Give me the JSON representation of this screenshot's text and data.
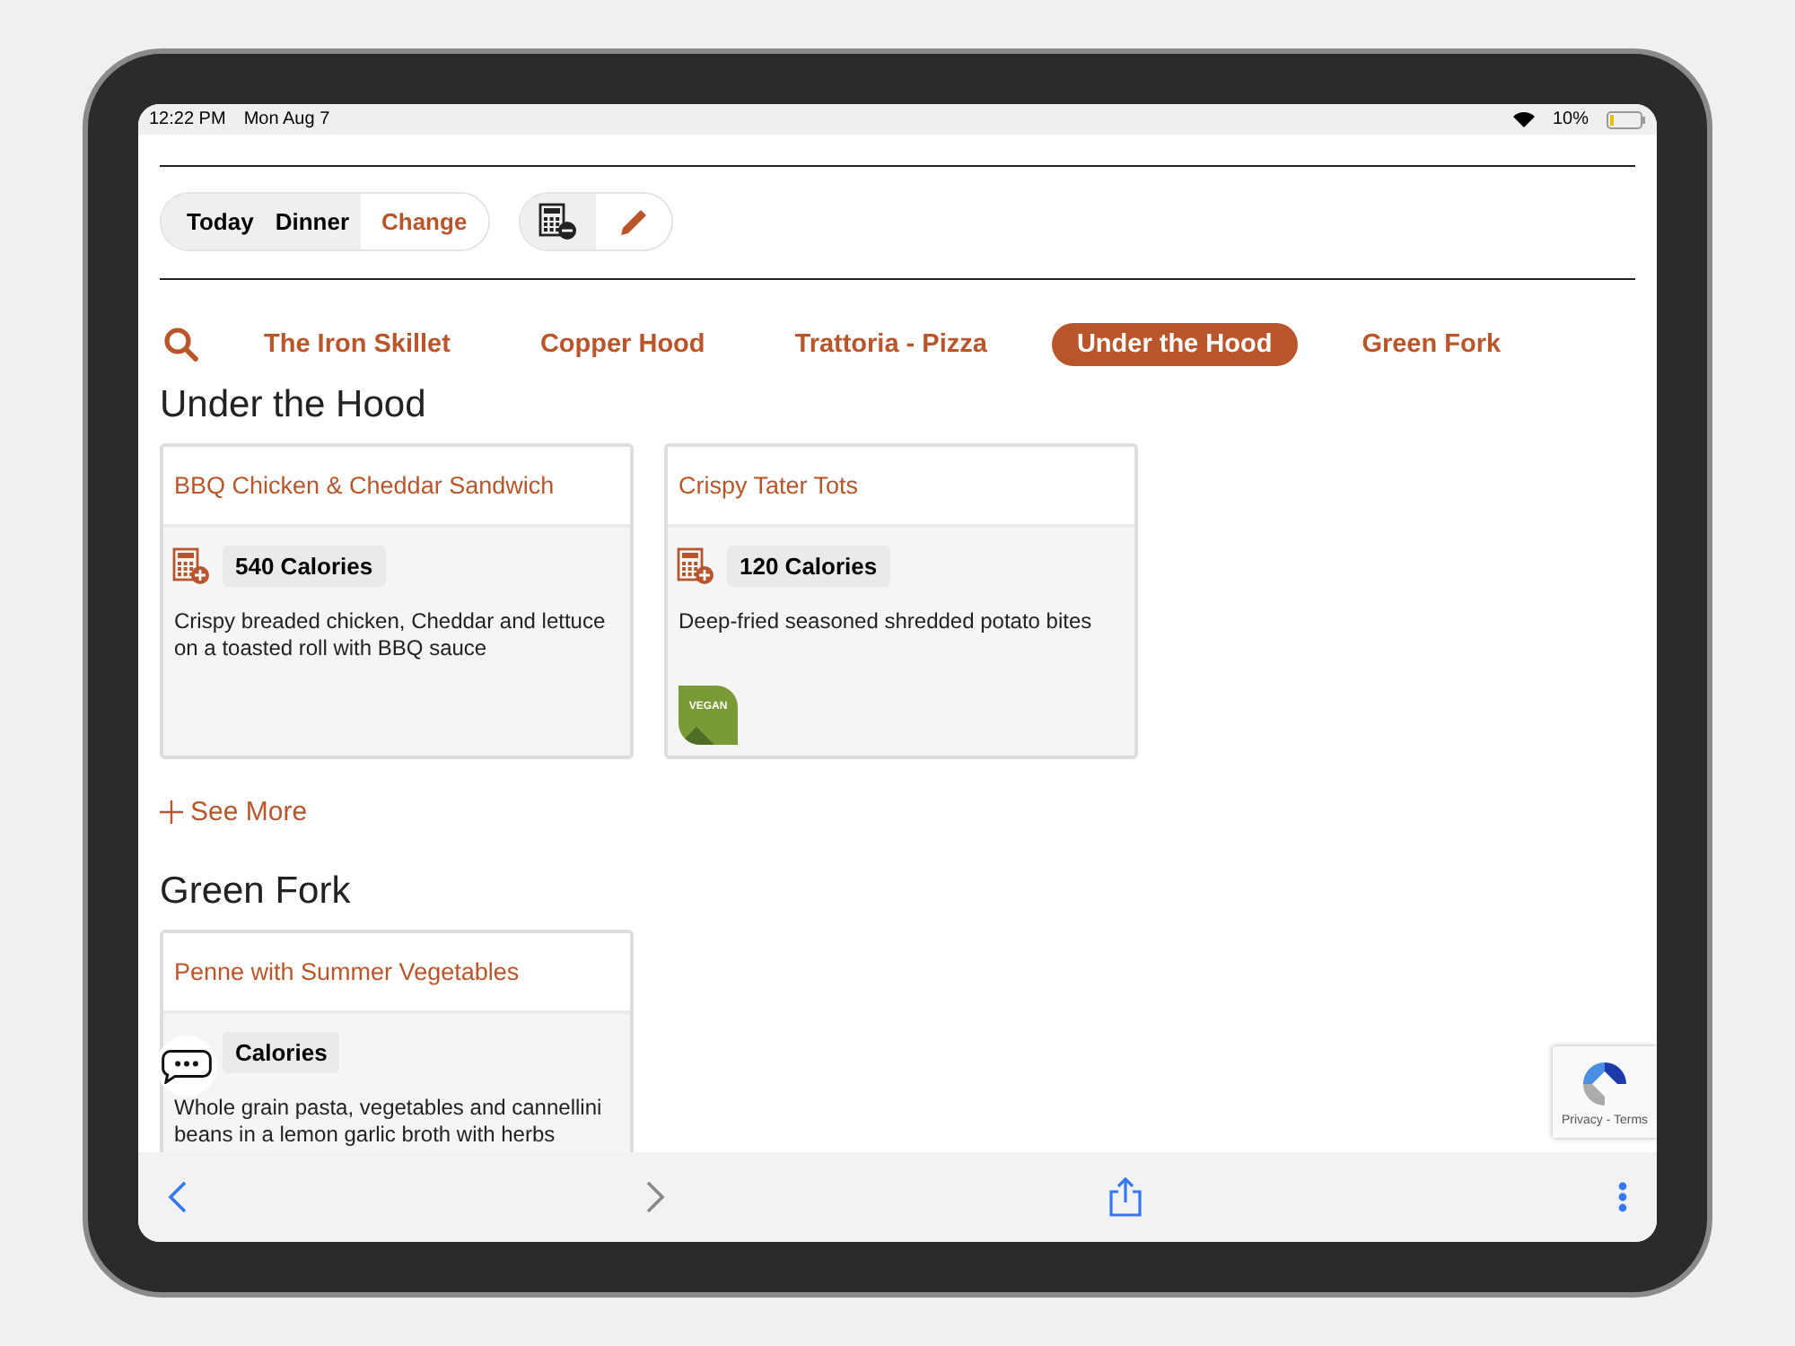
{
  "status_bar": {
    "time": "12:22 PM",
    "date": "Mon Aug 7",
    "battery": "10%"
  },
  "meal_selector": {
    "day": "Today",
    "meal": "Dinner",
    "change": "Change"
  },
  "tabs": [
    {
      "label": "The Iron Skillet",
      "selected": false
    },
    {
      "label": "Copper Hood",
      "selected": false
    },
    {
      "label": "Trattoria - Pizza",
      "selected": false
    },
    {
      "label": "Under the Hood",
      "selected": true
    },
    {
      "label": "Green Fork",
      "selected": false
    }
  ],
  "sections": [
    {
      "title": "Under the Hood",
      "see_more": "See More",
      "items": [
        {
          "name": "BBQ Chicken & Cheddar Sandwich",
          "calculator_icon": true,
          "calories": "540 Calories",
          "description": "Crispy breaded chicken, Cheddar and lettuce on a toasted roll with BBQ sauce"
        },
        {
          "name": "Crispy Tater Tots",
          "calculator_icon": true,
          "calories": "120 Calories",
          "description": "Deep-fried seasoned shredded potato bites",
          "badges": [
            "VEGAN"
          ]
        }
      ]
    },
    {
      "title": "Green Fork",
      "items": [
        {
          "name": "Penne with Summer Vegetables",
          "calculator_icon": false,
          "calories": "Calories",
          "description": "Whole grain pasta, vegetables and cannellini beans in a lemon garlic broth with herbs"
        }
      ]
    }
  ],
  "recaptcha": {
    "links": "Privacy - Terms"
  }
}
